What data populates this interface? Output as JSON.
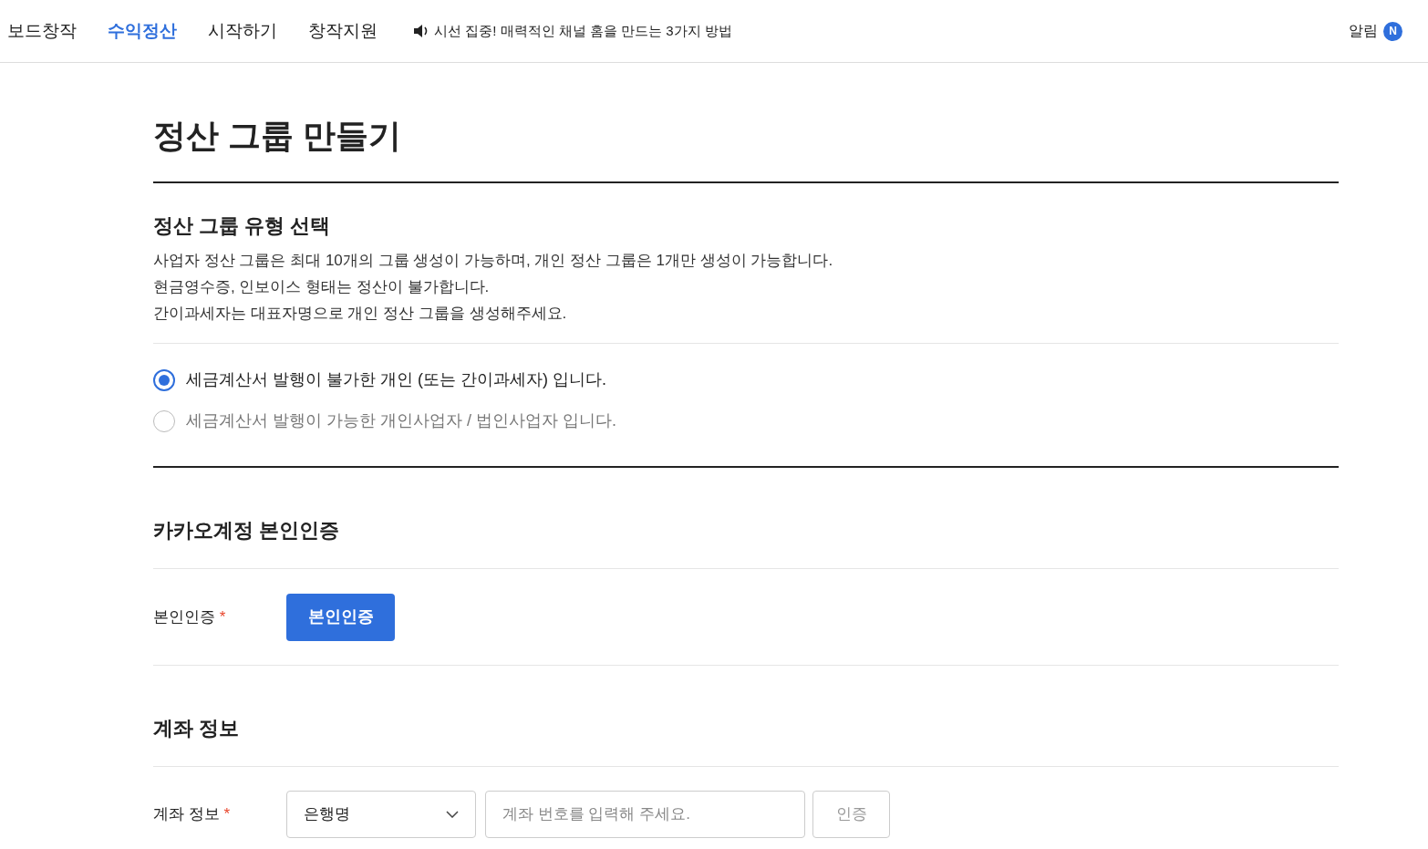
{
  "nav": {
    "items": [
      {
        "label": "보드창작",
        "selected": false
      },
      {
        "label": "수익정산",
        "selected": true
      },
      {
        "label": "시작하기",
        "selected": false
      },
      {
        "label": "창작지원",
        "selected": false
      }
    ],
    "notice": "시선 집중! 매력적인 채널 홈을 만드는 3가지 방법",
    "alarm": "알림",
    "alarm_badge": "N"
  },
  "title": "정산 그룹 만들기",
  "type_section": {
    "title": "정산 그룹 유형 선택",
    "lines": [
      "사업자 정산 그룹은 최대 10개의 그룹 생성이 가능하며, 개인 정산 그룹은 1개만 생성이 가능합니다.",
      "현금영수증, 인보이스 형태는 정산이 불가합니다.",
      "간이과세자는 대표자명으로 개인 정산 그룹을 생성해주세요."
    ],
    "options": [
      {
        "label": "세금계산서 발행이 불가한 개인 (또는 간이과세자) 입니다.",
        "selected": true
      },
      {
        "label": "세금계산서 발행이 가능한 개인사업자 / 법인사업자 입니다.",
        "selected": false
      }
    ]
  },
  "auth_section": {
    "title": "카카오계정 본인인증",
    "label": "본인인증",
    "required": "*",
    "button": "본인인증"
  },
  "account_section": {
    "title": "계좌 정보",
    "label": "계좌 정보",
    "required": "*",
    "bank_select": "은행명",
    "account_placeholder": "계좌 번호를 입력해 주세요.",
    "verify_button": "인증"
  }
}
